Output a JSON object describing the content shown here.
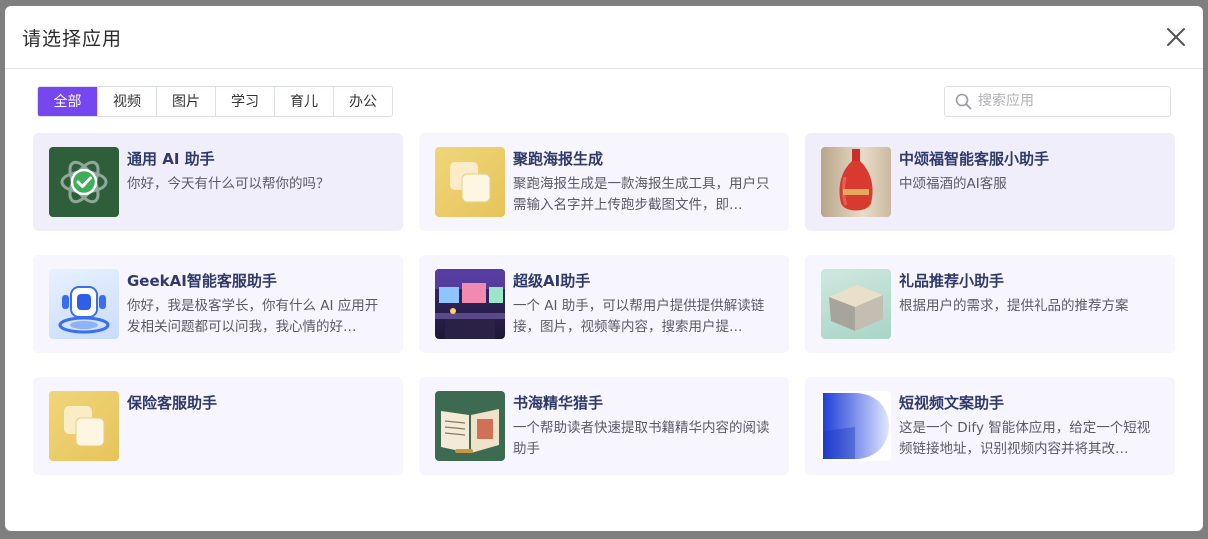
{
  "modal": {
    "title": "请选择应用"
  },
  "tabs": [
    {
      "label": "全部"
    },
    {
      "label": "视频"
    },
    {
      "label": "图片"
    },
    {
      "label": "学习"
    },
    {
      "label": "育儿"
    },
    {
      "label": "办公"
    }
  ],
  "search": {
    "placeholder": "搜索应用",
    "value": ""
  },
  "apps": [
    {
      "title": "通用 AI 助手",
      "desc": "你好，今天有什么可以帮你的吗？",
      "icon": "openai-check-icon"
    },
    {
      "title": "聚跑海报生成",
      "desc": "聚跑海报生成是一款海报生成工具，用户只需输入名字并上传跑步截图文件，即…",
      "icon": "yellow-cards-icon"
    },
    {
      "title": "中颂福智能客服小助手",
      "desc": "中颂福酒的AI客服",
      "icon": "red-vase-image"
    },
    {
      "title": "GeekAI智能客服助手",
      "desc": "你好，我是极客学长，你有什么 AI 应用开发相关问题都可以问我，我心情的好…",
      "icon": "robot-platform-icon"
    },
    {
      "title": "超级AI助手",
      "desc": "一个 AI 助手，可以帮用户提供提供解读链接，图片，视频等内容，搜索用户提…",
      "icon": "desk-setup-image"
    },
    {
      "title": "礼品推荐小助手",
      "desc": "根据用户的需求，提供礼品的推荐方案",
      "icon": "gift-box-image"
    },
    {
      "title": "保险客服助手",
      "desc": "",
      "icon": "yellow-cards-icon"
    },
    {
      "title": "书海精华猎手",
      "desc": "一个帮助读者快速提取书籍精华内容的阅读助手",
      "icon": "open-book-image"
    },
    {
      "title": "短视频文案助手",
      "desc": "这是一个 Dify 智能体应用，给定一个短视频链接地址，识别视频内容并将其改…",
      "icon": "dify-logo-icon"
    }
  ],
  "colors": {
    "accent": "#7646f0",
    "card_bg": "#f1eefc",
    "title": "#2f3a6b"
  }
}
